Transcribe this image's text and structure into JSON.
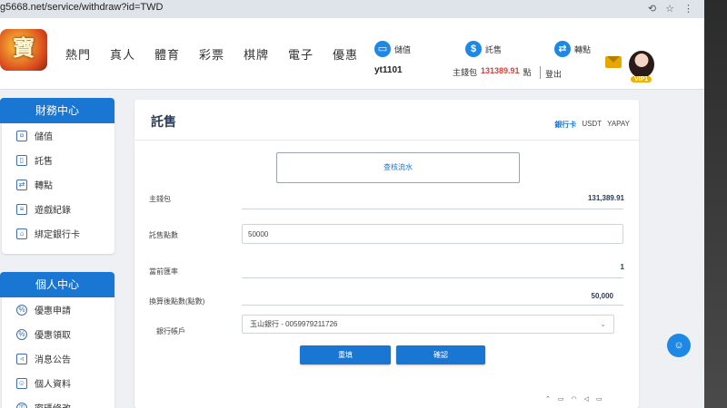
{
  "browser": {
    "url": "g5668.net/service/withdraw?id=TWD"
  },
  "logo": {
    "text": "寶"
  },
  "nav": {
    "items": [
      "熱門",
      "真人",
      "體育",
      "彩票",
      "棋牌",
      "電子",
      "優惠"
    ],
    "deposit_label": "儲值",
    "withdraw_label": "託售",
    "transfer_label": "轉點",
    "username": "yt1101",
    "main_wallet_label": "主錢包",
    "main_wallet_amount": "131389.91",
    "main_wallet_unit": "點",
    "logout_label": "登出",
    "vip_label": "VIP1"
  },
  "finance_panel": {
    "title": "財務中心",
    "items": [
      {
        "label": "儲值"
      },
      {
        "label": "託售"
      },
      {
        "label": "轉點"
      },
      {
        "label": "遊戲紀錄"
      },
      {
        "label": "綁定銀行卡"
      }
    ]
  },
  "personal_panel": {
    "title": "個人中心",
    "items": [
      {
        "label": "優惠申請"
      },
      {
        "label": "優惠領取"
      },
      {
        "label": "消息公告"
      },
      {
        "label": "個人資料"
      },
      {
        "label": "密碼修改"
      }
    ]
  },
  "main": {
    "title": "託售",
    "tabs": [
      "銀行卡",
      "USDT",
      "YAPAY"
    ],
    "query_button": "查核流水",
    "main_wallet_label": "主錢包",
    "main_wallet_value": "131,389.91",
    "sell_points_label": "託售點數",
    "sell_points_value": "50000",
    "exchange_rate_label": "當前匯率",
    "exchange_rate_value": "1",
    "converted_label": "換算後點數(點數)",
    "converted_value": "50,000",
    "bank_account_label": "銀行帳戶",
    "bank_account_value": "玉山銀行 - 0059979211726",
    "reset_button": "重填",
    "confirm_button": "確認"
  },
  "colors": {
    "accent": "#1976d2",
    "amount_red": "#e53935"
  }
}
